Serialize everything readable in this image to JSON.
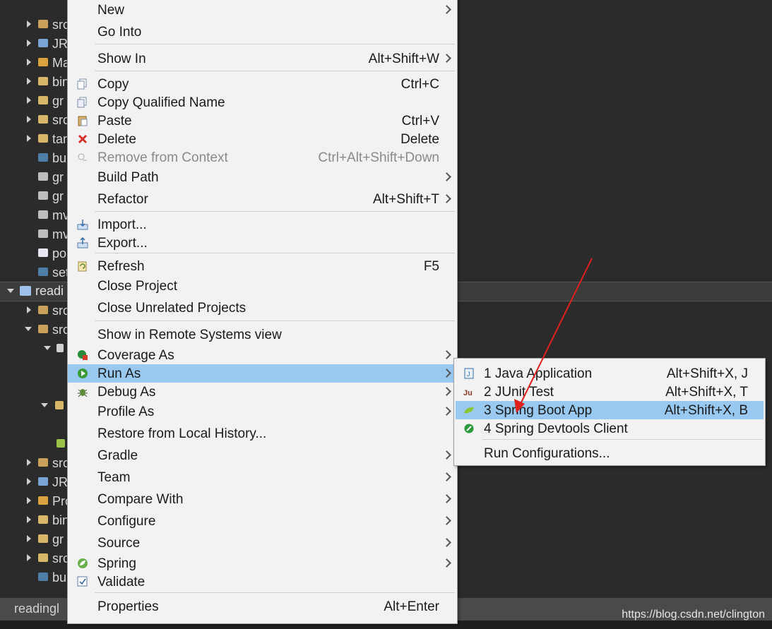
{
  "tree": {
    "rows": [
      {
        "label": "src"
      },
      {
        "label": "JR"
      },
      {
        "label": "Ma"
      },
      {
        "label": "bin"
      },
      {
        "label": "gr"
      },
      {
        "label": "src"
      },
      {
        "label": "tar"
      },
      {
        "label": "bu"
      },
      {
        "label": "gr"
      },
      {
        "label": "gr"
      },
      {
        "label": "mv"
      },
      {
        "label": "mv"
      },
      {
        "label": "po"
      },
      {
        "label": "set"
      }
    ],
    "project_label": "readi",
    "rows2": [
      {
        "label": "src"
      },
      {
        "label": "src"
      }
    ],
    "rows3": [
      {
        "label": "src"
      },
      {
        "label": "JR"
      },
      {
        "label": "Pro"
      },
      {
        "label": "bin"
      },
      {
        "label": "gr"
      },
      {
        "label": "src"
      },
      {
        "label": "bu"
      }
    ]
  },
  "status_bar": {
    "label": "readingl"
  },
  "watermark": "https://blog.csdn.net/clington",
  "context_menu": {
    "new": "New",
    "go_into": "Go Into",
    "show_in": "Show In",
    "show_in_accel": "Alt+Shift+W",
    "copy": "Copy",
    "copy_accel": "Ctrl+C",
    "copy_qualified": "Copy Qualified Name",
    "paste": "Paste",
    "paste_accel": "Ctrl+V",
    "delete": "Delete",
    "delete_accel": "Delete",
    "remove_context": "Remove from Context",
    "remove_context_accel": "Ctrl+Alt+Shift+Down",
    "build_path": "Build Path",
    "refactor": "Refactor",
    "refactor_accel": "Alt+Shift+T",
    "import": "Import...",
    "export": "Export...",
    "refresh": "Refresh",
    "refresh_accel": "F5",
    "close_project": "Close Project",
    "close_unrelated": "Close Unrelated Projects",
    "show_remote": "Show in Remote Systems view",
    "coverage_as": "Coverage As",
    "run_as": "Run As",
    "debug_as": "Debug As",
    "profile_as": "Profile As",
    "restore_history": "Restore from Local History...",
    "gradle": "Gradle",
    "team": "Team",
    "compare_with": "Compare With",
    "configure": "Configure",
    "source": "Source",
    "spring": "Spring",
    "validate": "Validate",
    "properties": "Properties",
    "properties_accel": "Alt+Enter"
  },
  "run_as_submenu": {
    "java_app": "1 Java Application",
    "java_app_accel": "Alt+Shift+X, J",
    "junit": "2 JUnit Test",
    "junit_accel": "Alt+Shift+X, T",
    "spring_boot": "3 Spring Boot App",
    "spring_boot_accel": "Alt+Shift+X, B",
    "devtools": "4 Spring Devtools Client",
    "run_configs": "Run Configurations..."
  },
  "colors": {
    "highlight": "#99c9f1",
    "annotation_arrow": "#e0201a"
  }
}
